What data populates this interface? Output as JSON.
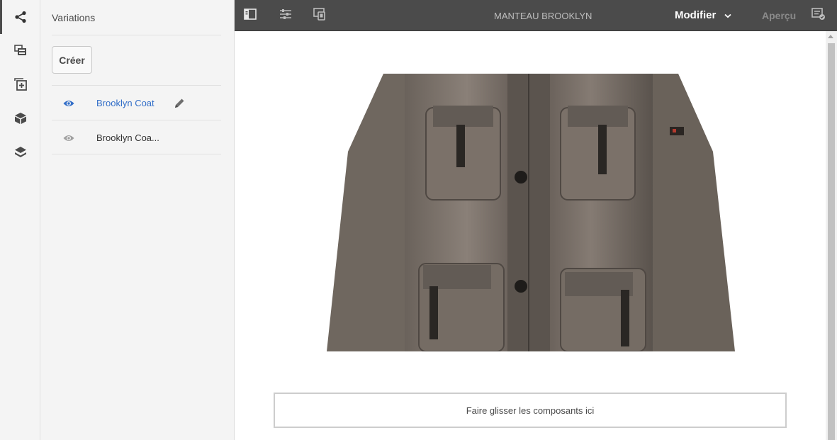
{
  "rail": {
    "items": [
      {
        "icon": "share-nodes-icon",
        "active": true
      },
      {
        "icon": "assets-icon",
        "active": false
      },
      {
        "icon": "components-add-icon",
        "active": false
      },
      {
        "icon": "cube-icon",
        "active": false
      },
      {
        "icon": "layers-icon",
        "active": false
      }
    ]
  },
  "panel": {
    "title": "Variations",
    "create_label": "Créer",
    "variations": [
      {
        "label": "Brooklyn Coat",
        "active": true
      },
      {
        "label": "Brooklyn Coa...",
        "active": false
      }
    ]
  },
  "toolbar": {
    "title": "MANTEAU BROOKLYN",
    "mode_label": "Modifier",
    "preview_label": "Aperçu"
  },
  "canvas": {
    "image_alt": "product-coat-image",
    "dropzone_label": "Faire glisser les composants ici"
  },
  "colors": {
    "toolbar_bg": "#4b4b4b",
    "panel_bg": "#f4f4f4",
    "accent": "#326ec8"
  }
}
